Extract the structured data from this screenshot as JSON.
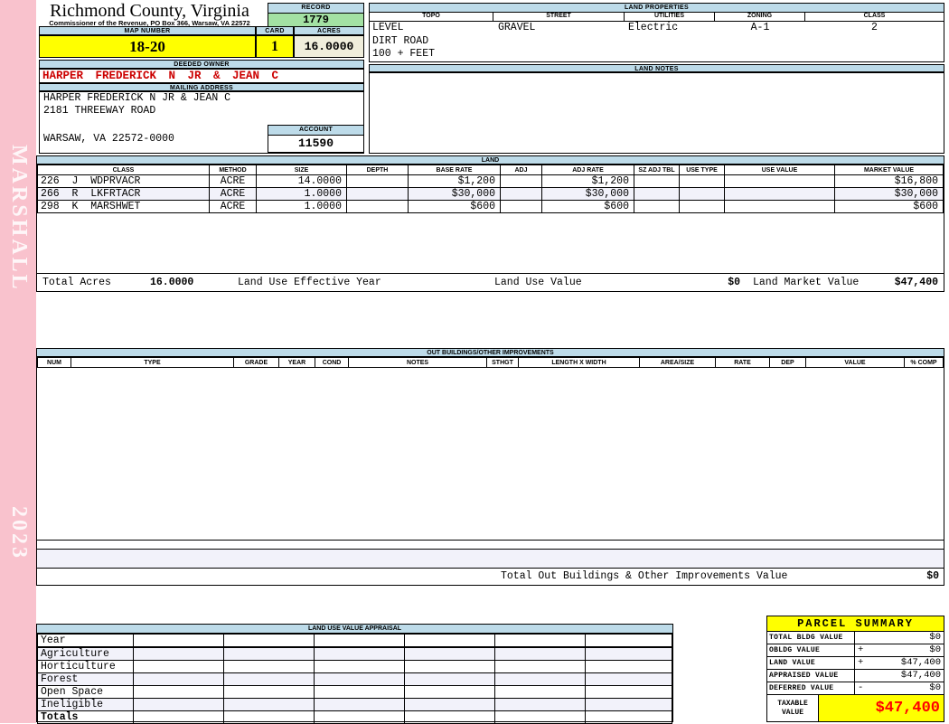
{
  "header": {
    "county": "Richmond County, Virginia",
    "commissioner": "Commissioner of the Revenue, PO Box 366, Warsaw, VA 22572",
    "record_label": "RECORD",
    "record_value": "1779",
    "map_number_label": "MAP NUMBER",
    "map_number_value": "18-20",
    "card_label": "CARD",
    "card_value": "1",
    "acres_label": "ACRES",
    "acres_value": "16.0000"
  },
  "sidebar": {
    "name": "MARSHALL",
    "year": "2023"
  },
  "land_properties": {
    "title": "LAND PROPERTIES",
    "columns": [
      "TOPO",
      "STREET",
      "UTILITIES",
      "ZONING",
      "CLASS"
    ],
    "values": [
      "LEVEL",
      "GRAVEL",
      "Electric",
      "A-1",
      "2"
    ],
    "extra_line1": "DIRT ROAD",
    "extra_line2": "100 + FEET"
  },
  "land_notes": {
    "title": "LAND NOTES"
  },
  "owner": {
    "deeded_owner_label": "DEEDED OWNER",
    "name": "HARPER FREDERICK N JR & JEAN C",
    "mailing_address_label": "MAILING ADDRESS",
    "address_line1": "HARPER FREDERICK N JR & JEAN C",
    "address_line2": "2181 THREEWAY ROAD",
    "address_line3": "WARSAW, VA 22572-0000",
    "account_label": "ACCOUNT",
    "account_value": "11590"
  },
  "land": {
    "title": "LAND",
    "columns": [
      "CLASS",
      "METHOD",
      "SIZE",
      "DEPTH",
      "BASE RATE",
      "ADJ",
      "ADJ RATE",
      "SZ ADJ TBL",
      "USE TYPE",
      "USE VALUE",
      "MARKET VALUE"
    ],
    "rows": [
      {
        "class": "226  J  WDPRVACR",
        "method": "ACRE",
        "size": "14.0000",
        "depth": "",
        "base_rate": "$1,200",
        "adj": "",
        "adj_rate": "$1,200",
        "sz_adj_tbl": "",
        "use_type": "",
        "use_value": "",
        "market_value": "$16,800"
      },
      {
        "class": "266  R  LKFRTACR",
        "method": "ACRE",
        "size": "1.0000",
        "depth": "",
        "base_rate": "$30,000",
        "adj": "",
        "adj_rate": "$30,000",
        "sz_adj_tbl": "",
        "use_type": "",
        "use_value": "",
        "market_value": "$30,000"
      },
      {
        "class": "298  K  MARSHWET",
        "method": "ACRE",
        "size": "1.0000",
        "depth": "",
        "base_rate": "$600",
        "adj": "",
        "adj_rate": "$600",
        "sz_adj_tbl": "",
        "use_type": "",
        "use_value": "",
        "market_value": "$600"
      }
    ],
    "totals": {
      "total_acres_label": "Total Acres",
      "total_acres_value": "16.0000",
      "effective_year_label": "Land Use Effective Year",
      "use_value_label": "Land Use Value",
      "use_value": "$0",
      "market_value_label": "Land Market Value",
      "market_value": "$47,400"
    }
  },
  "out_buildings": {
    "title": "OUT BUILDINGS/OTHER IMPROVEMENTS",
    "columns": [
      "NUM",
      "TYPE",
      "GRADE",
      "YEAR",
      "COND",
      "NOTES",
      "STHGT",
      "LENGTH X WIDTH",
      "AREA/SIZE",
      "RATE",
      "DEP",
      "VALUE",
      "% COMP"
    ],
    "total_label": "Total Out Buildings & Other Improvements Value",
    "total_value": "$0"
  },
  "land_use_appraisal": {
    "title": "LAND USE VALUE APPRAISAL",
    "row_labels": [
      "Year",
      "Agriculture",
      "Horticulture",
      "Forest",
      "Open Space",
      "Ineligible",
      "Totals"
    ]
  },
  "parcel_summary": {
    "title": "PARCEL SUMMARY",
    "rows": [
      {
        "label": "TOTAL BLDG VALUE",
        "op": "",
        "value": "$0"
      },
      {
        "label": "OBLDG VALUE",
        "op": "+",
        "value": "$0"
      },
      {
        "label": "LAND VALUE",
        "op": "+",
        "value": "$47,400"
      },
      {
        "label": "APPRAISED VALUE",
        "op": "",
        "value": "$47,400"
      },
      {
        "label": "DEFERRED VALUE",
        "op": "-",
        "value": "$0"
      }
    ],
    "taxable_label": "TAXABLE\nVALUE",
    "taxable_value": "$47,400"
  },
  "colors": {
    "header_blue": "#BDDBE9",
    "record_green": "#A3E1A3",
    "highlight_yellow": "#FFFF00",
    "acres_cream": "#F0EEDC",
    "owner_red": "#CC0000",
    "taxable_red": "#FF0000",
    "sidebar_pink": "#F9C2CD",
    "row_band": "#F2F2FA"
  }
}
